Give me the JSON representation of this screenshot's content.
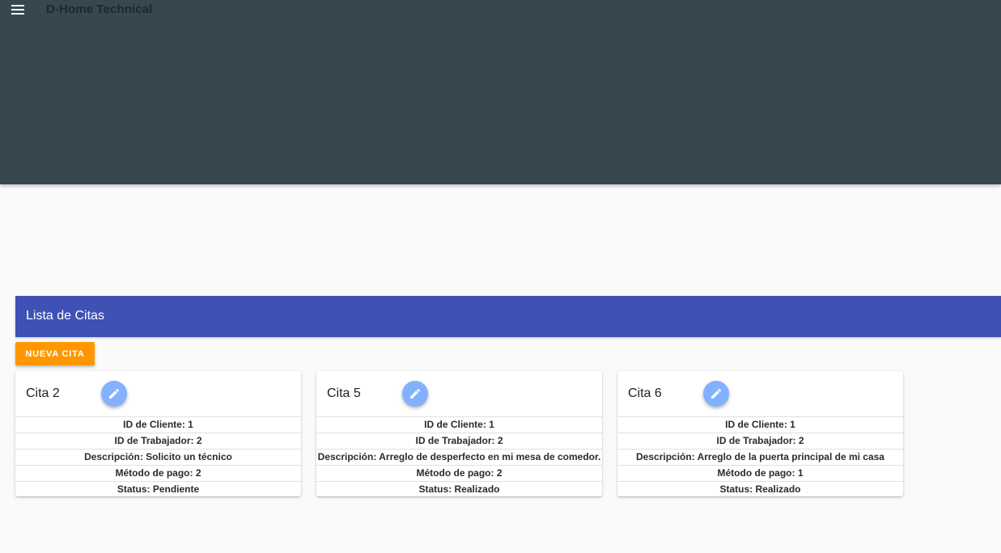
{
  "toolbar": {
    "title": "D-Home Technical",
    "menu_icon": "menu-icon",
    "background": "#37474f"
  },
  "section": {
    "title": "Lista de Citas",
    "background": "#3f51b5"
  },
  "new_button": {
    "label": "Nueva Cita",
    "color": "#ff9800"
  },
  "edit_icon": "pencil-icon",
  "edit_button_color": "#82b1ff",
  "cards": [
    {
      "title": "Cita 2",
      "cliente": "ID de Cliente: 1",
      "trabajador": "ID de Trabajador: 2",
      "descripcion": "Descripción: Solicito un técnico",
      "metodo": "Método de pago: 2",
      "status": "Status: Pendiente"
    },
    {
      "title": "Cita 5",
      "cliente": "ID de Cliente: 1",
      "trabajador": "ID de Trabajador: 2",
      "descripcion": "Descripción: Arreglo de desperfecto en mi mesa de comedor.",
      "metodo": "Método de pago: 2",
      "status": "Status: Realizado"
    },
    {
      "title": "Cita 6",
      "cliente": "ID de Cliente: 1",
      "trabajador": "ID de Trabajador: 2",
      "descripcion": "Descripción: Arreglo de la puerta principal de mi casa",
      "metodo": "Método de pago: 1",
      "status": "Status: Realizado"
    }
  ]
}
